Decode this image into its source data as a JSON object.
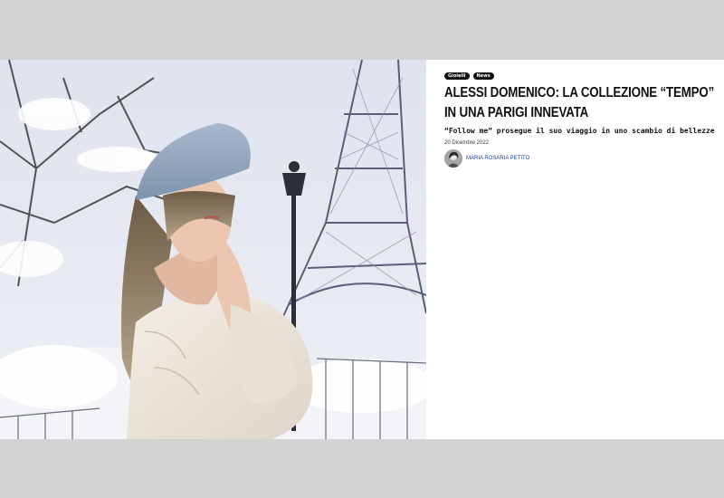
{
  "article": {
    "tags": [
      "Gioielli",
      "News"
    ],
    "title": "ALESSI DOMENICO: LA COLLEZIONE “TEMPO” IN UNA PARIGI INNEVATA",
    "subtitle": "“Follow me” prosegue il suo viaggio in uno scambio di bellezze",
    "date": "20 Dicembre 2022",
    "author": "MARIA ROSARIA PETITO"
  },
  "colors": {
    "page_background": "#d3d3d3",
    "card_background": "#ffffff",
    "tag_background": "#111111",
    "author_link": "#1b3fa0"
  },
  "icons": {
    "avatar": "author-avatar-photo"
  }
}
